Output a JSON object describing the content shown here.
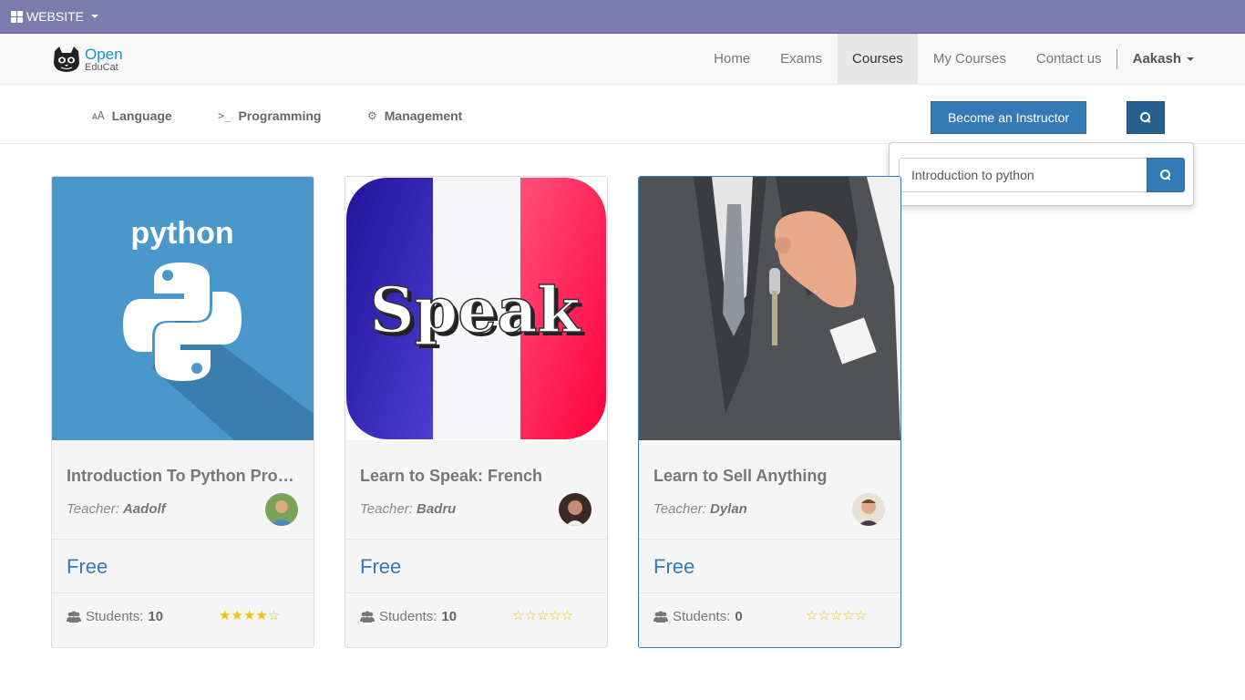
{
  "adminbar": {
    "website_label": "WEBSITE"
  },
  "logo": {
    "line1": "Open",
    "line2": "EduCat"
  },
  "nav": {
    "items": [
      {
        "label": "Home"
      },
      {
        "label": "Exams"
      },
      {
        "label": "Courses",
        "active": true
      },
      {
        "label": "My Courses"
      },
      {
        "label": "Contact us"
      }
    ],
    "user": "Aakash"
  },
  "categories": [
    {
      "label": "Language",
      "icon": "language-icon"
    },
    {
      "label": "Programming",
      "icon": "terminal-icon"
    },
    {
      "label": "Management",
      "icon": "gear-icon"
    }
  ],
  "become_instructor": "Become an Instructor",
  "search": {
    "value": "Introduction to python"
  },
  "courses": [
    {
      "title": "Introduction To Python Programming",
      "teacher_prefix": "Teacher:",
      "teacher": "Aadolf",
      "price": "Free",
      "students_label": "Students:",
      "students": "10",
      "rating": "★★★★☆",
      "image_text": "python"
    },
    {
      "title": "Learn to Speak: French",
      "teacher_prefix": "Teacher:",
      "teacher": "Badru",
      "price": "Free",
      "students_label": "Students:",
      "students": "10",
      "rating": "☆☆☆☆☆",
      "image_text": "Speak"
    },
    {
      "title": "Learn to Sell Anything",
      "teacher_prefix": "Teacher:",
      "teacher": "Dylan",
      "price": "Free",
      "students_label": "Students:",
      "students": "0",
      "rating": "☆☆☆☆☆",
      "image_text": ""
    }
  ],
  "colors": {
    "adminbar": "#7c7bad",
    "primary": "#337ab7",
    "star": "#f0c20c"
  }
}
